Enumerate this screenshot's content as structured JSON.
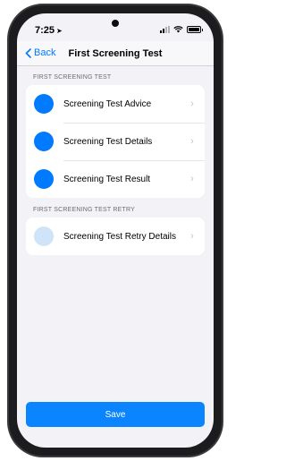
{
  "status_bar": {
    "time": "7:25",
    "location_arrow": "➤"
  },
  "nav": {
    "back_label": "Back",
    "title": "First Screening Test"
  },
  "sections": [
    {
      "header": "FIRST SCREENING TEST",
      "items": [
        {
          "label": "Screening Test Advice",
          "icon": "blue-circle-icon"
        },
        {
          "label": "Screening Test Details",
          "icon": "blue-circle-icon"
        },
        {
          "label": "Screening Test Result",
          "icon": "blue-circle-icon"
        }
      ]
    },
    {
      "header": "FIRST SCREENING TEST RETRY",
      "items": [
        {
          "label": "Screening Test Retry Details",
          "icon": "light-blue-circle-icon"
        }
      ]
    }
  ],
  "save_label": "Save",
  "colors": {
    "accent": "#007aff",
    "button": "#0a84ff",
    "background": "#f2f2f7",
    "disabled_dot": "#cfe3f9"
  }
}
